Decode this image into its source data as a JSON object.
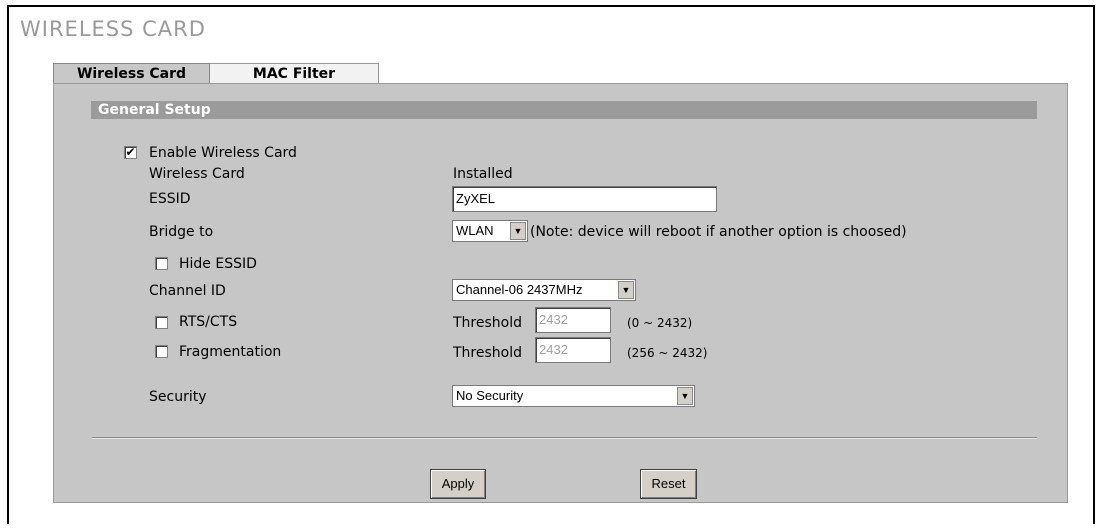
{
  "page": {
    "title": "WIRELESS CARD"
  },
  "tabs": [
    {
      "label": "Wireless Card"
    },
    {
      "label": "MAC Filter"
    }
  ],
  "section": {
    "title": "General Setup"
  },
  "form": {
    "enable_card": {
      "label": "Enable Wireless Card",
      "checked": true
    },
    "wireless_card": {
      "label": "Wireless Card",
      "value": "Installed"
    },
    "essid": {
      "label": "ESSID",
      "value": "ZyXEL"
    },
    "bridge": {
      "label": "Bridge to",
      "value": "WLAN",
      "note": "(Note: device will reboot if another option is choosed)"
    },
    "hide_essid": {
      "label": "Hide ESSID",
      "checked": false
    },
    "channel": {
      "label": "Channel ID",
      "value": "Channel-06 2437MHz"
    },
    "rts": {
      "label": "RTS/CTS",
      "checked": false,
      "threshold_label": "Threshold",
      "threshold_value": "2432",
      "range": "(0 ~ 2432)"
    },
    "fragmentation": {
      "label": "Fragmentation",
      "checked": false,
      "threshold_label": "Threshold",
      "threshold_value": "2432",
      "range": "(256 ~ 2432)"
    },
    "security": {
      "label": "Security",
      "value": "No Security"
    }
  },
  "buttons": {
    "apply": "Apply",
    "reset": "Reset"
  },
  "glyphs": {
    "check": "✔",
    "dropdown_arrow": "▼"
  }
}
